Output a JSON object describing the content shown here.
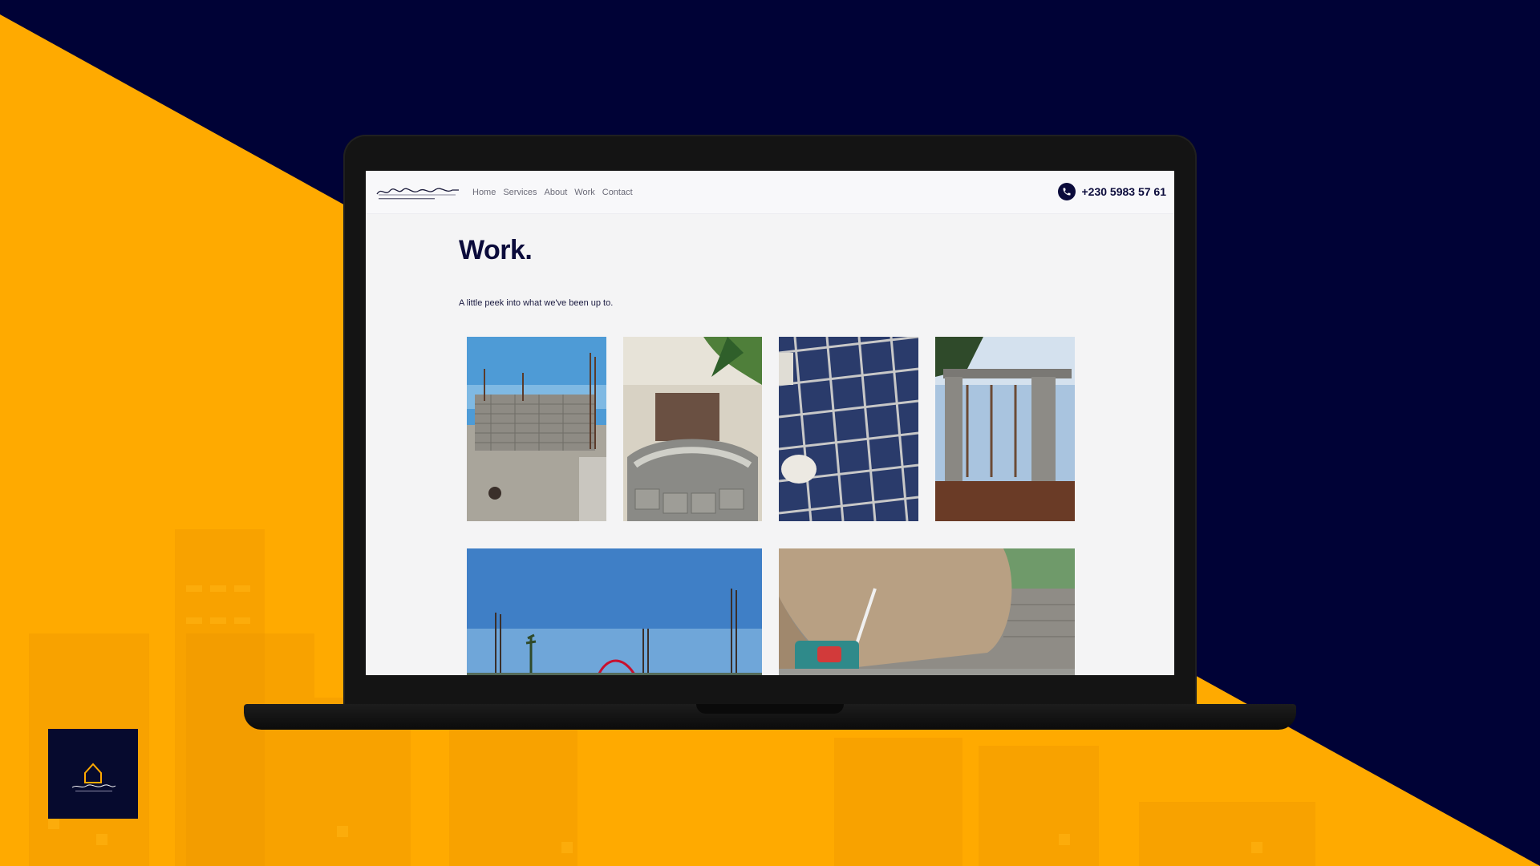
{
  "colors": {
    "navy": "#000236",
    "accent_orange": "#ffaa00",
    "brand_text": "#0b0b3b",
    "screen_bg": "#f4f4f5"
  },
  "nav": {
    "links": [
      "Home",
      "Services",
      "About",
      "Work",
      "Contact"
    ],
    "phone": "+230 5983 57 61",
    "phone_icon": "phone-icon"
  },
  "main": {
    "title": "Work.",
    "subtitle": "A little peek into what we've been up to."
  },
  "gallery": {
    "images": [
      "block-wall-with-rebar",
      "curved-stone-planter",
      "rebar-mesh-closeup",
      "concrete-frame-structure",
      "rebar-columns-sky",
      "worker-with-tape-measure"
    ]
  },
  "brand": {
    "logo": "house-logo-icon"
  }
}
